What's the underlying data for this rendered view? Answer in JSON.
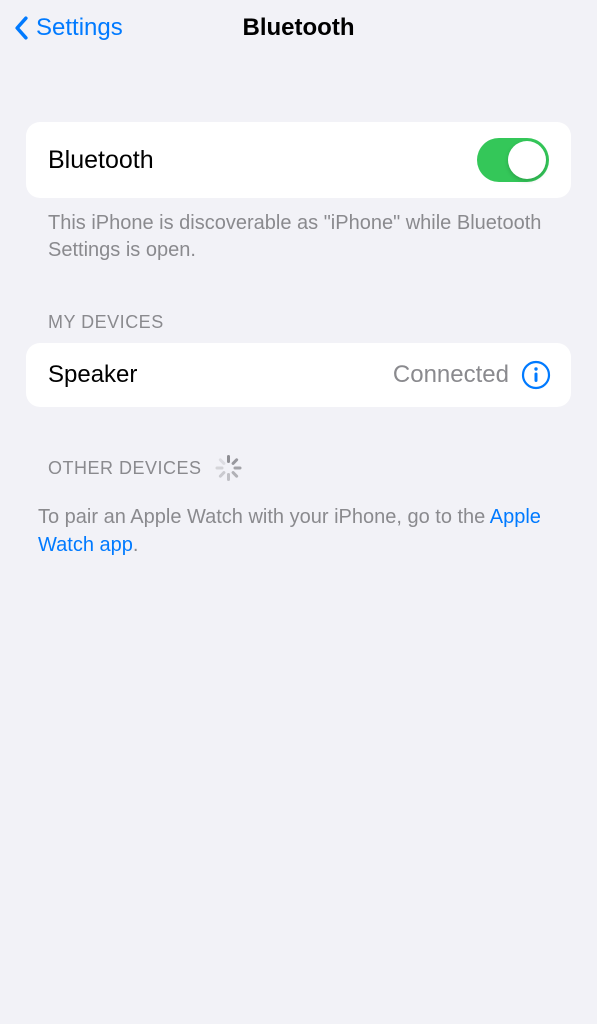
{
  "nav": {
    "back_label": "Settings",
    "title": "Bluetooth"
  },
  "bluetooth": {
    "label": "Bluetooth",
    "footer": "This iPhone is discoverable as \"iPhone\" while Bluetooth Settings is open."
  },
  "my_devices": {
    "header": "MY DEVICES",
    "items": [
      {
        "name": "Speaker",
        "status": "Connected"
      }
    ]
  },
  "other_devices": {
    "header": "OTHER DEVICES",
    "pair_prefix": "To pair an Apple Watch with your iPhone, go to the ",
    "pair_link": "Apple Watch app",
    "pair_suffix": "."
  }
}
